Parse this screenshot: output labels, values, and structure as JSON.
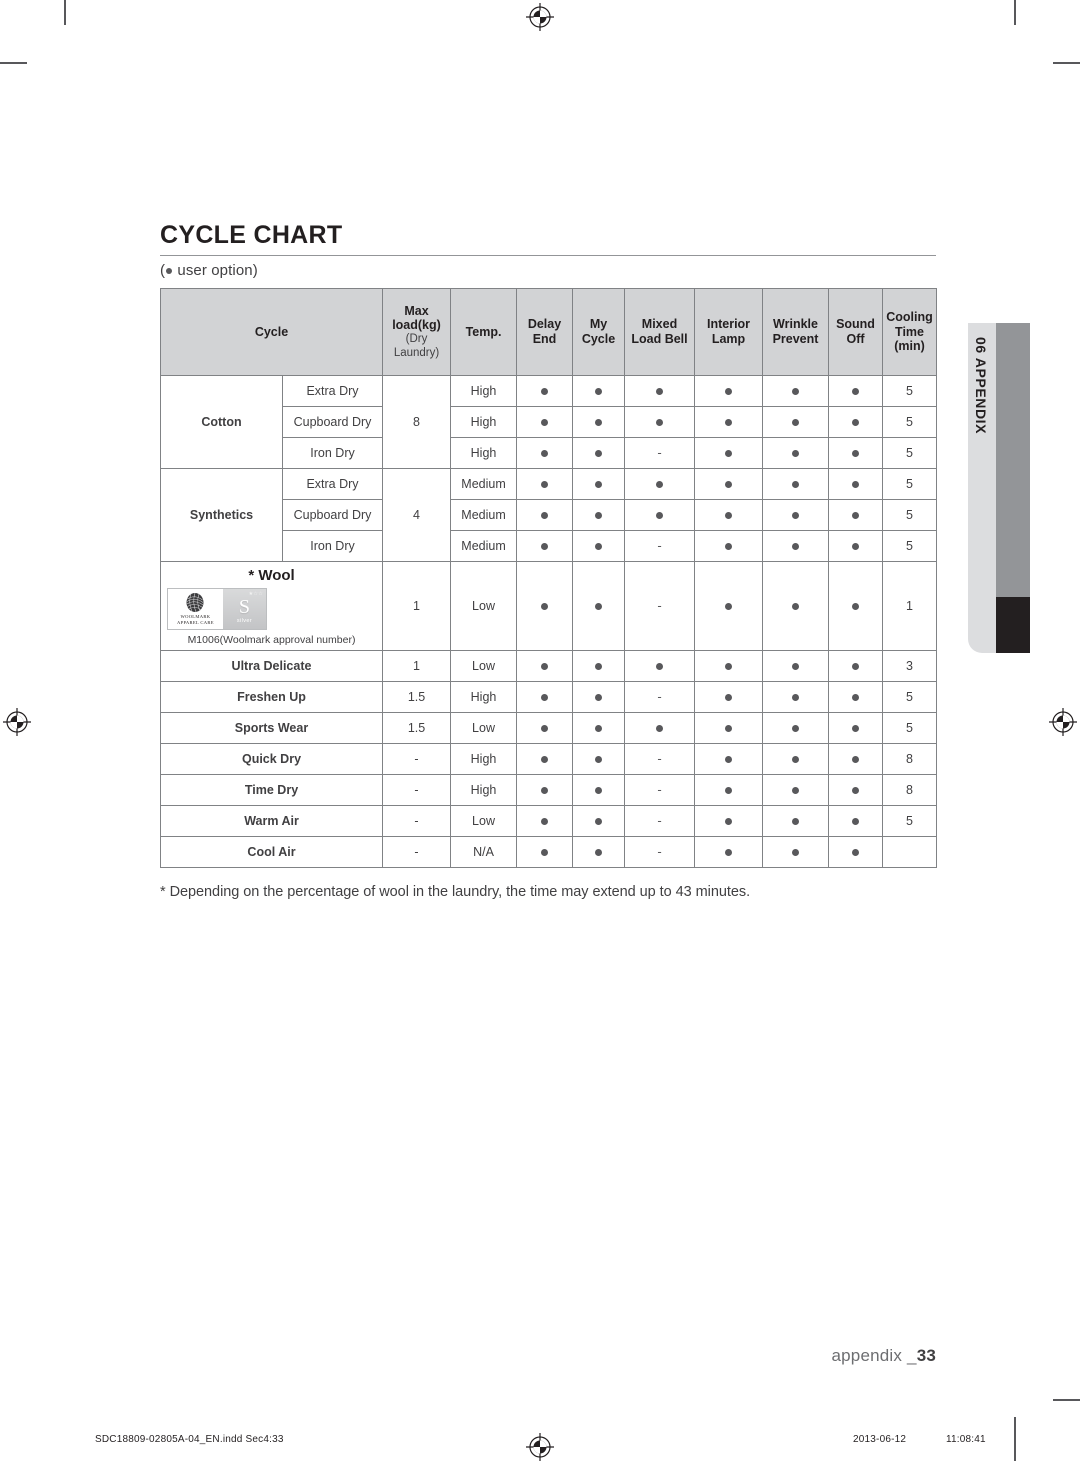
{
  "document": {
    "title": "CYCLE CHART",
    "user_option_note": "user option",
    "user_option_prefix": "(",
    "user_option_suffix": ")",
    "footnote": "* Depending on the percentage of wool in the laundry, the time may extend up to 43 minutes.",
    "folio_label": "appendix _",
    "folio_number": "33"
  },
  "side_tab": {
    "label": "06 APPENDIX"
  },
  "print_footer": {
    "filename": "SDC18809-02805A-04_EN.indd   Sec4:33",
    "date": "2013-06-12",
    "time": "11:08:41"
  },
  "table": {
    "headers": {
      "cycle": "Cycle",
      "max_load": "Max load(kg)",
      "max_load_sub": "(Dry Laundry)",
      "temp": "Temp.",
      "delay_end": "Delay End",
      "my_cycle": "My Cycle",
      "mixed_load_bell": "Mixed Load Bell",
      "interior_lamp": "Interior Lamp",
      "wrinkle_prevent": "Wrinkle Prevent",
      "sound_off": "Sound Off",
      "cooling_time": "Cooling Time (min)"
    },
    "rows": [
      {
        "category": "Cotton",
        "sub": "Extra Dry",
        "max_load": "8",
        "temp": "High",
        "delay_end": "dot",
        "my_cycle": "dot",
        "mixed_load_bell": "dot",
        "interior_lamp": "dot",
        "wrinkle_prevent": "dot",
        "sound_off": "dot",
        "cooling_time": "5"
      },
      {
        "category": "Cotton",
        "sub": "Cupboard Dry",
        "max_load": "8",
        "temp": "High",
        "delay_end": "dot",
        "my_cycle": "dot",
        "mixed_load_bell": "dot",
        "interior_lamp": "dot",
        "wrinkle_prevent": "dot",
        "sound_off": "dot",
        "cooling_time": "5"
      },
      {
        "category": "Cotton",
        "sub": "Iron Dry",
        "max_load": "8",
        "temp": "High",
        "delay_end": "dot",
        "my_cycle": "dot",
        "mixed_load_bell": "-",
        "interior_lamp": "dot",
        "wrinkle_prevent": "dot",
        "sound_off": "dot",
        "cooling_time": "5"
      },
      {
        "category": "Synthetics",
        "sub": "Extra Dry",
        "max_load": "4",
        "temp": "Medium",
        "delay_end": "dot",
        "my_cycle": "dot",
        "mixed_load_bell": "dot",
        "interior_lamp": "dot",
        "wrinkle_prevent": "dot",
        "sound_off": "dot",
        "cooling_time": "5"
      },
      {
        "category": "Synthetics",
        "sub": "Cupboard Dry",
        "max_load": "4",
        "temp": "Medium",
        "delay_end": "dot",
        "my_cycle": "dot",
        "mixed_load_bell": "dot",
        "interior_lamp": "dot",
        "wrinkle_prevent": "dot",
        "sound_off": "dot",
        "cooling_time": "5"
      },
      {
        "category": "Synthetics",
        "sub": "Iron Dry",
        "max_load": "4",
        "temp": "Medium",
        "delay_end": "dot",
        "my_cycle": "dot",
        "mixed_load_bell": "-",
        "interior_lamp": "dot",
        "wrinkle_prevent": "dot",
        "sound_off": "dot",
        "cooling_time": "5"
      },
      {
        "category": "* Wool",
        "sub": "",
        "max_load": "1",
        "temp": "Low",
        "delay_end": "dot",
        "my_cycle": "dot",
        "mixed_load_bell": "-",
        "interior_lamp": "dot",
        "wrinkle_prevent": "dot",
        "sound_off": "dot",
        "cooling_time": "1"
      },
      {
        "category": "Ultra Delicate",
        "sub": "",
        "max_load": "1",
        "temp": "Low",
        "delay_end": "dot",
        "my_cycle": "dot",
        "mixed_load_bell": "dot",
        "interior_lamp": "dot",
        "wrinkle_prevent": "dot",
        "sound_off": "dot",
        "cooling_time": "3"
      },
      {
        "category": "Freshen Up",
        "sub": "",
        "max_load": "1.5",
        "temp": "High",
        "delay_end": "dot",
        "my_cycle": "dot",
        "mixed_load_bell": "-",
        "interior_lamp": "dot",
        "wrinkle_prevent": "dot",
        "sound_off": "dot",
        "cooling_time": "5"
      },
      {
        "category": "Sports Wear",
        "sub": "",
        "max_load": "1.5",
        "temp": "Low",
        "delay_end": "dot",
        "my_cycle": "dot",
        "mixed_load_bell": "dot",
        "interior_lamp": "dot",
        "wrinkle_prevent": "dot",
        "sound_off": "dot",
        "cooling_time": "5"
      },
      {
        "category": "Quick Dry",
        "sub": "",
        "max_load": "-",
        "temp": "High",
        "delay_end": "dot",
        "my_cycle": "dot",
        "mixed_load_bell": "-",
        "interior_lamp": "dot",
        "wrinkle_prevent": "dot",
        "sound_off": "dot",
        "cooling_time": "8"
      },
      {
        "category": "Time Dry",
        "sub": "",
        "max_load": "-",
        "temp": "High",
        "delay_end": "dot",
        "my_cycle": "dot",
        "mixed_load_bell": "-",
        "interior_lamp": "dot",
        "wrinkle_prevent": "dot",
        "sound_off": "dot",
        "cooling_time": "8"
      },
      {
        "category": "Warm Air",
        "sub": "",
        "max_load": "-",
        "temp": "Low",
        "delay_end": "dot",
        "my_cycle": "dot",
        "mixed_load_bell": "-",
        "interior_lamp": "dot",
        "wrinkle_prevent": "dot",
        "sound_off": "dot",
        "cooling_time": "5"
      },
      {
        "category": "Cool Air",
        "sub": "",
        "max_load": "-",
        "temp": "N/A",
        "delay_end": "dot",
        "my_cycle": "dot",
        "mixed_load_bell": "-",
        "interior_lamp": "dot",
        "wrinkle_prevent": "dot",
        "sound_off": "dot",
        "cooling_time": ""
      }
    ]
  },
  "wool_block": {
    "title": "* Wool",
    "logo_brand_line1": "WOOLMARK",
    "logo_brand_line2": "APPAREL CARE",
    "logo_badge_letter": "S",
    "logo_badge_text": "silver",
    "logo_stars": "★☆☆",
    "approval_text": "M1006(Woolmark approval number)"
  },
  "colors": {
    "header_fill": "#d2d3d5",
    "category_fill": "#e7e7e8",
    "sub_fill": "#f1f1f2",
    "border": "#808285",
    "bullet": "#58585b",
    "tab_label_fill": "#dcdddf",
    "tab_bar_fill": "#939598",
    "tab_current_fill": "#231f20"
  }
}
